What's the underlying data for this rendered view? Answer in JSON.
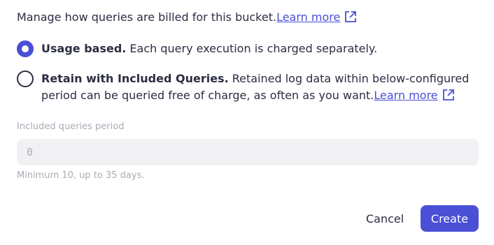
{
  "intro": {
    "text": "Manage how queries are billed for this bucket.",
    "link_label": "Learn more",
    "link_icon": "external-link-icon"
  },
  "options": [
    {
      "title": "Usage based.",
      "description": " Each query execution is charged separately.",
      "selected": true
    },
    {
      "title": "Retain with Included Queries.",
      "description": " Retained log data within below-configured period can be queried free of charge, as often as you want.",
      "link_label": "Learn more",
      "link_icon": "external-link-icon",
      "selected": false
    }
  ],
  "field": {
    "label": "Included queries period",
    "placeholder": "0",
    "hint": "Minimum 10, up to 35 days."
  },
  "actions": {
    "cancel_label": "Cancel",
    "create_label": "Create"
  },
  "colors": {
    "accent": "#4a4fd6",
    "text": "#2b2d42",
    "muted": "#a9abb6",
    "input_bg": "#f1f1f4"
  }
}
